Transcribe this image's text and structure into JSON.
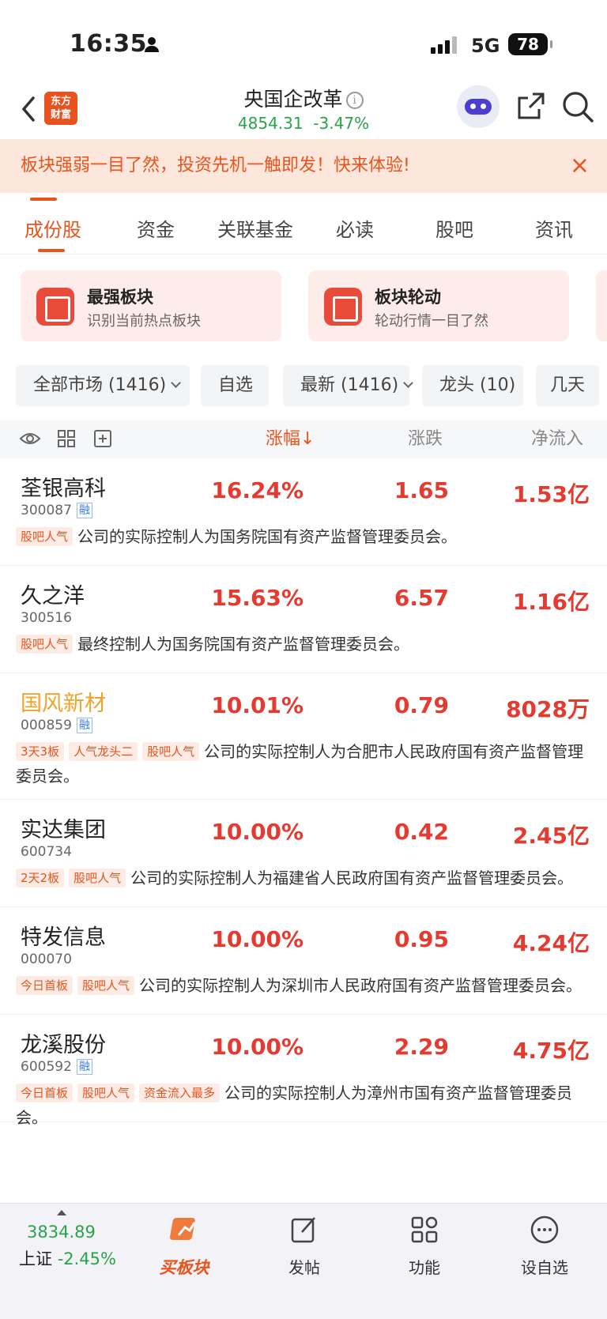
{
  "status_bar": {
    "time": "16:35",
    "network": "5G",
    "battery": "78"
  },
  "header": {
    "logo_line1": "东方",
    "logo_line2": "财富",
    "title": "央国企改革",
    "info_icon": "i",
    "index_value": "4854.31",
    "index_change": "-3.47%"
  },
  "banner": {
    "text": "板块强弱一目了然，投资先机一触即发！快来体验!",
    "close": "×"
  },
  "tabs": [
    "成份股",
    "资金",
    "关联基金",
    "必读",
    "股吧",
    "资讯"
  ],
  "cards": [
    {
      "title": "最强板块",
      "desc": "识别当前热点板块"
    },
    {
      "title": "板块轮动",
      "desc": "轮动行情一目了然"
    }
  ],
  "filters": [
    {
      "label": "全部市场 (1416)",
      "dropdown": true
    },
    {
      "label": "自选",
      "dropdown": false
    },
    {
      "label": "最新 (1416)",
      "dropdown": true
    },
    {
      "label": "龙头 (10)",
      "dropdown": false
    },
    {
      "label": "几天",
      "dropdown": false
    }
  ],
  "columns": {
    "pct": "涨幅",
    "pct_arrow": "↓",
    "chg": "涨跌",
    "flow": "净流入"
  },
  "rong_label": "融",
  "stocks": [
    {
      "name": "荃银高科",
      "code": "300087",
      "rong": true,
      "highlight": false,
      "pct": "16.24%",
      "chg": "1.65",
      "flow": "1.53亿",
      "tags": [
        "股吧人气"
      ],
      "desc": "公司的实际控制人为国务院国有资产监督管理委员会。"
    },
    {
      "name": "久之洋",
      "code": "300516",
      "rong": false,
      "highlight": false,
      "pct": "15.63%",
      "chg": "6.57",
      "flow": "1.16亿",
      "tags": [
        "股吧人气"
      ],
      "desc": "最终控制人为国务院国有资产监督管理委员会。"
    },
    {
      "name": "国风新材",
      "code": "000859",
      "rong": true,
      "highlight": true,
      "pct": "10.01%",
      "chg": "0.79",
      "flow": "8028万",
      "tags": [
        "3天3板",
        "人气龙头二",
        "股吧人气"
      ],
      "desc": "公司的实际控制人为合肥市人民政府国有资产监督管理委员会。"
    },
    {
      "name": "实达集团",
      "code": "600734",
      "rong": false,
      "highlight": false,
      "pct": "10.00%",
      "chg": "0.42",
      "flow": "2.45亿",
      "tags": [
        "2天2板",
        "股吧人气"
      ],
      "desc": "公司的实际控制人为福建省人民政府国有资产监督管理委员会。"
    },
    {
      "name": "特发信息",
      "code": "000070",
      "rong": false,
      "highlight": false,
      "pct": "10.00%",
      "chg": "0.95",
      "flow": "4.24亿",
      "tags": [
        "今日首板",
        "股吧人气"
      ],
      "desc": "公司的实际控制人为深圳市人民政府国有资产监督管理委员会。"
    },
    {
      "name": "龙溪股份",
      "code": "600592",
      "rong": true,
      "highlight": false,
      "pct": "10.00%",
      "chg": "2.29",
      "flow": "4.75亿",
      "tags": [
        "今日首板",
        "股吧人气",
        "资金流入最多"
      ],
      "desc": "公司的实际控制人为漳州市国有资产监督管理委员会。"
    }
  ],
  "bottom": {
    "index_value": "3834.89",
    "index_name": "上证",
    "index_change": "-2.45%",
    "nav": [
      "买板块",
      "发帖",
      "功能",
      "设自选"
    ]
  },
  "colors": {
    "accent": "#e8541c",
    "up": "#e53a2f",
    "down": "#2aa34a",
    "highlight_name": "#f0a32a"
  }
}
